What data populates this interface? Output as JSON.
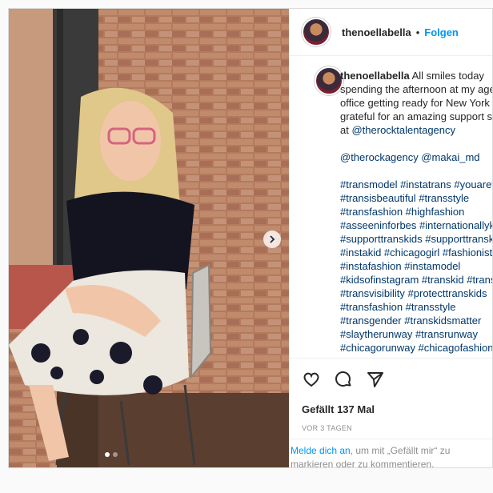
{
  "post": {
    "username": "thenoellabella",
    "follow_label": "Folgen",
    "separator": "•",
    "caption_text": "All smiles today\nspending the afternoon at my agency\noffice getting ready for New York\ngrateful for an amazing support system\nat ",
    "mention_agency": "@therocktalentagency",
    "mentions_line": "@therockagency @makai_md",
    "hashtags": [
      "#transmodel #instatrans #youarevalid",
      "#transisbeautiful #transstyle",
      "#transfashion #highfashion",
      "#asseeninforbes #internationallyknown",
      "#supporttranskids #supporttranskids",
      "#instakid #chicagogirl #fashionista",
      "#instafashion #instamodel",
      "#kidsofinstagram #transkid #transgirl",
      "#transvisibility #protecttranskids",
      "#transfashion #transstyle",
      "#transgender #transkidsmatter",
      "#slaytherunway #transrunway",
      "#chicagorunway #chicagofashion"
    ],
    "likes": "Gefällt 137 Mal",
    "date": "VOR 3 TAGEN",
    "login_link": "Melde dich an",
    "login_text": ", um mit „Gefällt mir“ zu markieren oder zu kommentieren.",
    "icons": [
      "heart-icon",
      "comment-icon",
      "share-icon",
      "chevron-right-icon"
    ],
    "accent_color": "#0095f6"
  }
}
